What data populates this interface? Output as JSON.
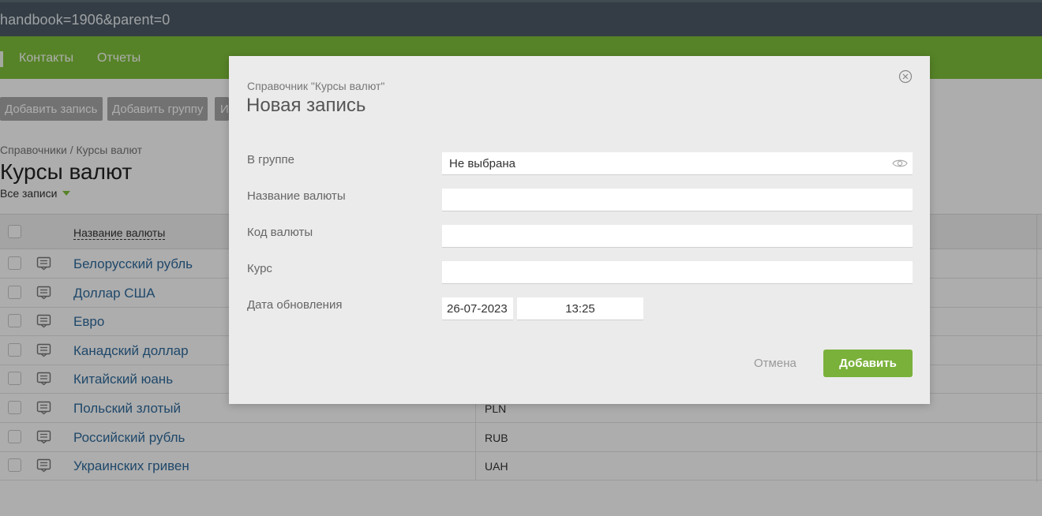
{
  "browser": {
    "url": "handbook=1906&parent=0"
  },
  "nav": {
    "items": [
      "Контакты",
      "Отчеты"
    ]
  },
  "toolbar": {
    "buttons": [
      "Добавить запись",
      "Добавить группу",
      "Из"
    ]
  },
  "breadcrumb": {
    "root": "Справочники",
    "separator": "/",
    "current": "Курсы валют"
  },
  "page_title": "Курсы валют",
  "filter_label": "Все записи",
  "table": {
    "header": "Название валюты",
    "rows": [
      {
        "name": "Белорусский рубль",
        "code": ""
      },
      {
        "name": "Доллар США",
        "code": ""
      },
      {
        "name": "Евро",
        "code": ""
      },
      {
        "name": "Канадский доллар",
        "code": ""
      },
      {
        "name": "Китайский юань",
        "code": ""
      },
      {
        "name": "Польский злотый",
        "code": "PLN"
      },
      {
        "name": "Российский рубль",
        "code": "RUB"
      },
      {
        "name": "Украинских гривен",
        "code": "UAH"
      }
    ]
  },
  "modal": {
    "subtitle": "Справочник \"Курсы валют\"",
    "title": "Новая запись",
    "fields": {
      "group": {
        "label": "В группе",
        "value": "Не выбрана"
      },
      "currency_name": {
        "label": "Название валюты",
        "value": ""
      },
      "currency_code": {
        "label": "Код валюты",
        "value": ""
      },
      "rate": {
        "label": "Курс",
        "value": ""
      },
      "updated": {
        "label": "Дата обновления",
        "date": "26-07-2023",
        "time": "13:25"
      }
    },
    "cancel_label": "Отмена",
    "submit_label": "Добавить"
  },
  "colors": {
    "nav_green": "#7fc23a",
    "button_green": "#7ab13a",
    "link_blue": "#2f6a9c",
    "address_bar": "#4d5b66"
  },
  "icons": {
    "close": "close-icon",
    "eye": "eye-icon",
    "record": "record-icon"
  }
}
